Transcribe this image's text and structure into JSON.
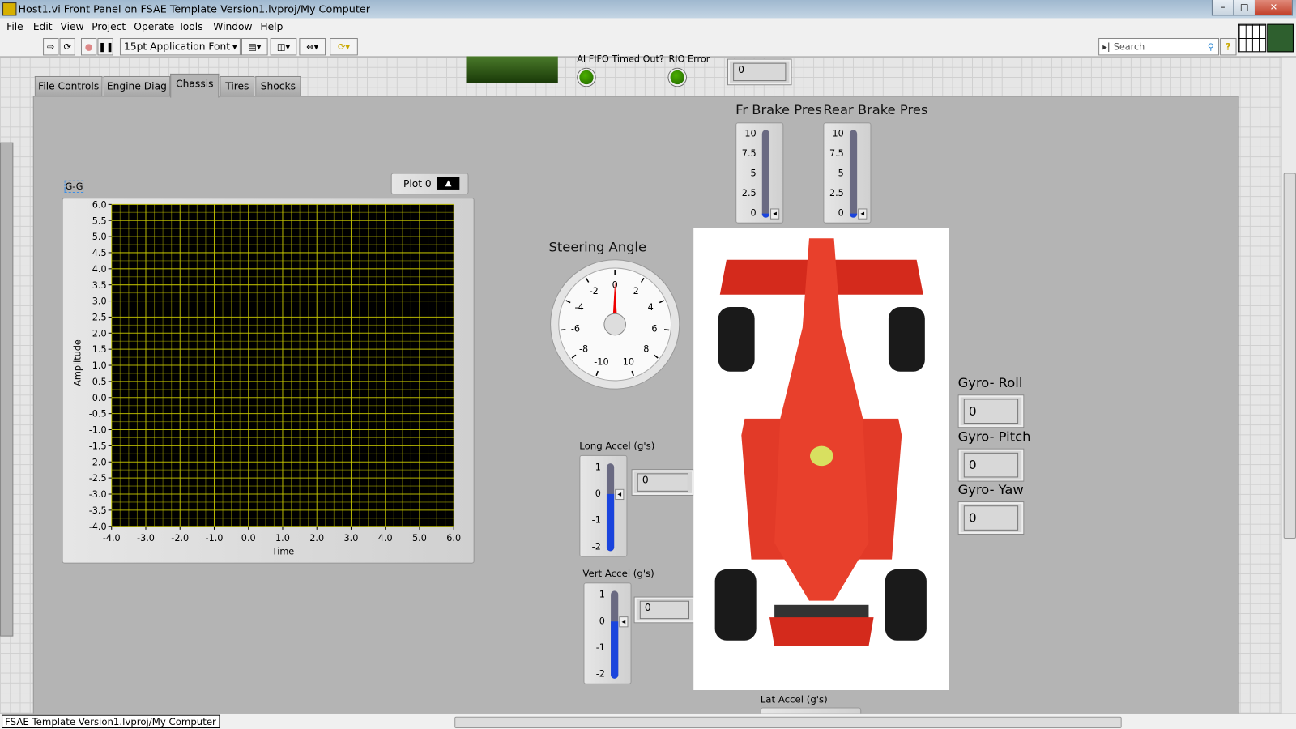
{
  "window": {
    "title": "Host1.vi Front Panel on FSAE Template Version1.lvproj/My Computer"
  },
  "menu": [
    "File",
    "Edit",
    "View",
    "Project",
    "Operate",
    "Tools",
    "Window",
    "Help"
  ],
  "toolbar": {
    "font": "15pt Application Font",
    "search_placeholder": "Search"
  },
  "top_indicators": {
    "ai_fifo_label": "AI FIFO Timed Out?",
    "rio_error_label": "RIO Error",
    "numeric_value": "0",
    "led_color": "#2e8b00"
  },
  "tabs": [
    {
      "label": "File Controls"
    },
    {
      "label": "Engine Diag"
    },
    {
      "label": "Chassis",
      "active": true
    },
    {
      "label": "Tires"
    },
    {
      "label": "Shocks"
    }
  ],
  "graph": {
    "label": "G-G",
    "legend": "Plot 0",
    "xlabel": "Time",
    "ylabel": "Amplitude",
    "plot_bg": "#000000",
    "grid_color": "#c8c800",
    "chart_data": {
      "type": "line",
      "title": "",
      "xlabel": "Time",
      "ylabel": "Amplitude",
      "xlim": [
        -4,
        6
      ],
      "ylim": [
        -4,
        6
      ],
      "grid": true,
      "x_ticks": [
        "-4.0",
        "-3.0",
        "-2.0",
        "-1.0",
        "0.0",
        "1.0",
        "2.0",
        "3.0",
        "4.0",
        "5.0",
        "6.0"
      ],
      "y_ticks": [
        "6.0",
        "5.5",
        "5.0",
        "4.5",
        "4.0",
        "3.5",
        "3.0",
        "2.5",
        "2.0",
        "1.5",
        "1.0",
        "0.5",
        "0.0",
        "-0.5",
        "-1.0",
        "-1.5",
        "-2.0",
        "-2.5",
        "-3.0",
        "-3.5",
        "-4.0"
      ],
      "series": [
        {
          "name": "Plot 0",
          "values": []
        }
      ]
    }
  },
  "brakes": [
    {
      "label": "Fr Brake Pres",
      "value": 0,
      "ticks": [
        "10",
        "7.5",
        "5",
        "2.5",
        "0"
      ]
    },
    {
      "label": "Rear Brake Pres",
      "value": 0,
      "ticks": [
        "10",
        "7.5",
        "5",
        "2.5",
        "0"
      ]
    }
  ],
  "steering": {
    "label": "Steering Angle",
    "value": 0,
    "ticks": [
      "-10",
      "-8",
      "-6",
      "-4",
      "-2",
      "0",
      "2",
      "4",
      "6",
      "8",
      "10"
    ]
  },
  "long_accel": {
    "label": "Long Accel (g's)",
    "value": "0",
    "ticks": [
      "1",
      "0",
      "-1",
      "-2"
    ]
  },
  "vert_accel": {
    "label": "Vert Accel (g's)",
    "value": "0",
    "ticks": [
      "1",
      "0",
      "-1",
      "-2"
    ]
  },
  "lat_accel": {
    "label": "Lat Accel (g's)"
  },
  "gyro": [
    {
      "label": "Gyro- Roll",
      "value": "0"
    },
    {
      "label": "Gyro- Pitch",
      "value": "0"
    },
    {
      "label": "Gyro- Yaw",
      "value": "0"
    }
  ],
  "status": {
    "path": "FSAE Template Version1.lvproj/My Computer"
  }
}
